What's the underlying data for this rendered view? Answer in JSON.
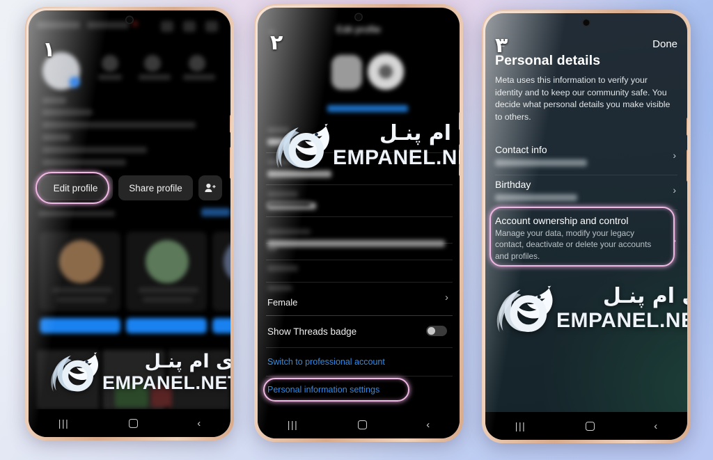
{
  "image": {
    "description": "Three-step Instagram tutorial screenshot showing phone screens",
    "accent_highlight": "#f0b8e4",
    "frame_color": "#e0b595"
  },
  "watermark": {
    "persian": "ای ام پنـل",
    "english": "EMPANEL.NET",
    "icon": "eagle-logo"
  },
  "steps": {
    "one": "۱",
    "two": "۲",
    "three": "۳"
  },
  "phone1": {
    "screen_name": "instagram-profile",
    "actions": {
      "edit_profile": "Edit profile",
      "share_profile": "Share profile",
      "add_people_icon": "add-person-icon"
    },
    "highlight_target": "Edit profile"
  },
  "phone2": {
    "screen_name": "edit-profile",
    "header": {
      "back_icon": "back-arrow-icon",
      "title": "Edit profile"
    },
    "avatar_link": "Edit picture or avatar",
    "fields": [
      {
        "label": "Name",
        "value": ""
      },
      {
        "label": "Username",
        "value": ""
      },
      {
        "label": "Pronouns",
        "value": ""
      },
      {
        "label": "Bio",
        "value": ""
      },
      {
        "label": "Add link",
        "value": ""
      },
      {
        "label": "Gender",
        "value": "Female"
      }
    ],
    "threads_badge": {
      "label": "Show Threads badge",
      "state": "off"
    },
    "links": [
      {
        "label": "Switch to professional account",
        "highlighted": false
      },
      {
        "label": "Personal information settings",
        "highlighted": true
      }
    ]
  },
  "phone3": {
    "screen_name": "personal-details",
    "header": {
      "back_icon": "back-arrow-icon",
      "done": "Done"
    },
    "title": "Personal details",
    "description": "Meta uses this information to verify your identity and to keep our community safe. You decide what personal details you make visible to others.",
    "items": [
      {
        "title": "Contact info",
        "subtitle": "",
        "highlighted": false
      },
      {
        "title": "Birthday",
        "subtitle": "",
        "highlighted": false
      },
      {
        "title": "Account ownership and control",
        "subtitle": "Manage your data, modify your legacy contact, deactivate or delete your accounts and profiles.",
        "highlighted": true
      }
    ],
    "chevron": "›"
  },
  "navbar": {
    "recents_icon": "recents-icon",
    "recents_glyph": "|||",
    "home_icon": "home-icon",
    "back_icon": "back-icon",
    "back_glyph": "‹"
  }
}
